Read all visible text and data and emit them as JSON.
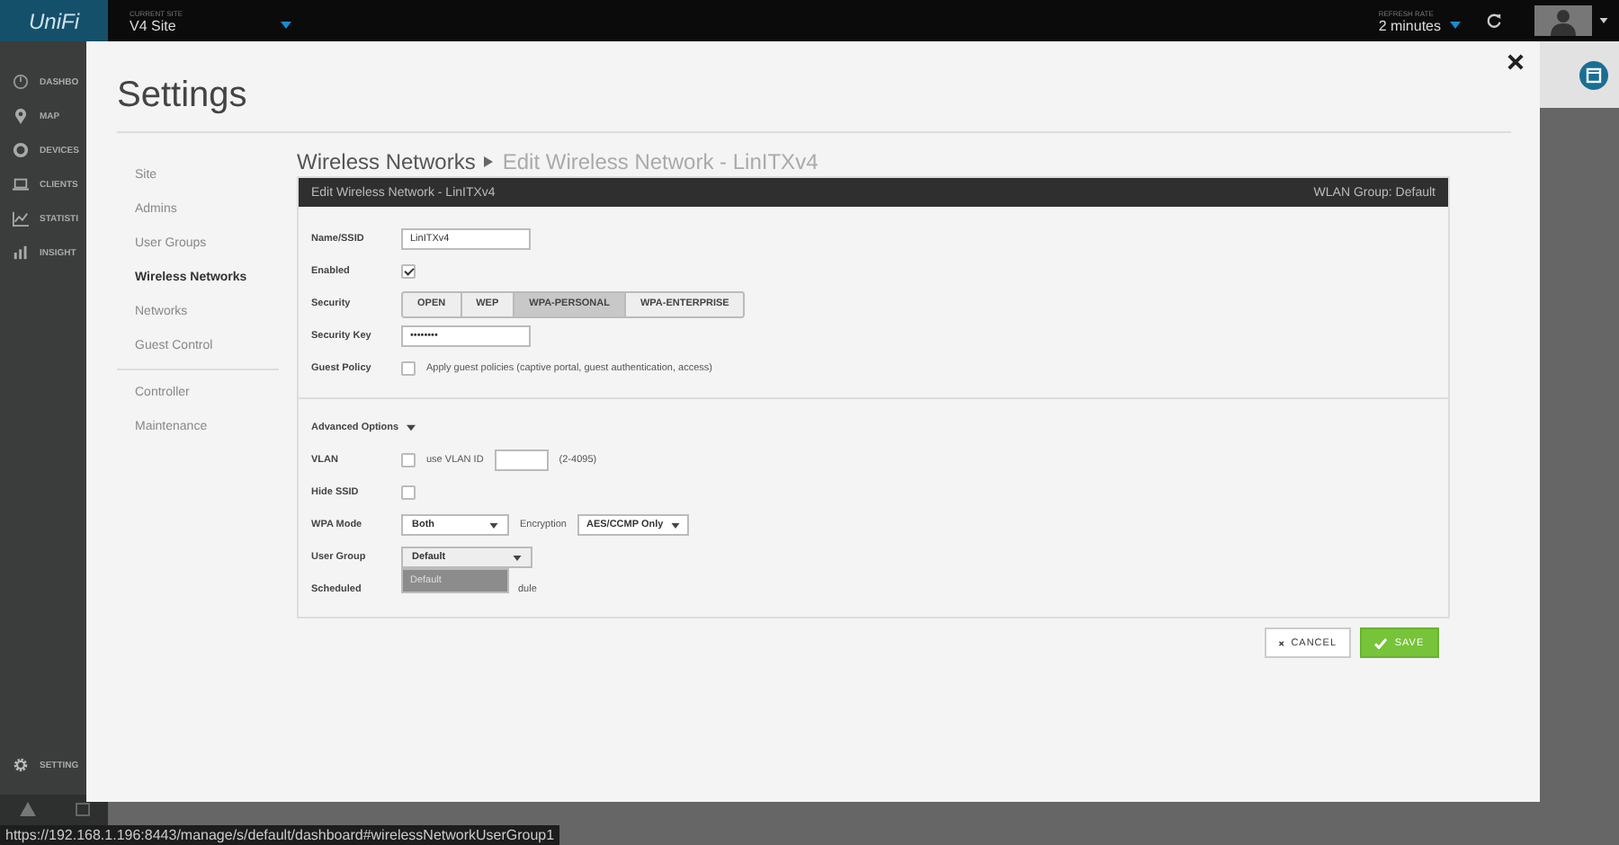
{
  "topbar": {
    "logo": "UniFi",
    "site_label": "CURRENT SITE",
    "site": "V4 Site",
    "refresh_label": "REFRESH RATE",
    "refresh": "2 minutes"
  },
  "sidebar": {
    "items": [
      {
        "kind": "dashboard",
        "label": "DASHBO"
      },
      {
        "kind": "map",
        "label": "MAP"
      },
      {
        "kind": "devices",
        "label": "DEVICES"
      },
      {
        "kind": "clients",
        "label": "CLIENTS"
      },
      {
        "kind": "statistics",
        "label": "STATISTI"
      },
      {
        "kind": "insights",
        "label": "INSIGHT"
      }
    ],
    "settings": "SETTING"
  },
  "modal": {
    "title": "Settings",
    "nav_groups": [
      [
        {
          "label": "Site",
          "selected": false
        },
        {
          "label": "Admins",
          "selected": false
        },
        {
          "label": "User Groups",
          "selected": false
        },
        {
          "label": "Wireless Networks",
          "selected": true
        },
        {
          "label": "Networks",
          "selected": false
        },
        {
          "label": "Guest Control",
          "selected": false
        }
      ],
      [
        {
          "label": "Controller",
          "selected": false
        },
        {
          "label": "Maintenance",
          "selected": false
        }
      ]
    ],
    "breadcrumb": [
      "Wireless Networks",
      "Edit Wireless Network - LinITXv4"
    ],
    "panel": {
      "title": "Edit Wireless Network - LinITXv4",
      "wlan_group": "WLAN Group: Default",
      "rows": [
        {
          "kind": "text",
          "label": "Name/SSID",
          "value": "LinITXv4"
        },
        {
          "kind": "checkbox",
          "label": "Enabled",
          "checked": true
        },
        {
          "kind": "segmented",
          "label": "Security",
          "options": [
            {
              "label": "OPEN",
              "selected": false
            },
            {
              "label": "WEP",
              "selected": false
            },
            {
              "label": "WPA-PERSONAL",
              "selected": true
            },
            {
              "label": "WPA-ENTERPRISE",
              "selected": false
            }
          ]
        },
        {
          "kind": "text",
          "label": "Security Key",
          "value": "••••••••"
        },
        {
          "kind": "checkbox",
          "label": "Guest Policy",
          "checked": false,
          "text": "Apply guest policies (captive portal, guest authentication, access)"
        }
      ],
      "advanced": {
        "label": "Advanced Options",
        "expanded": true,
        "rows": [
          {
            "kind": "vlan",
            "label": "VLAN",
            "checked": false,
            "text": "use VLAN ID",
            "hint": "(2-4095)"
          },
          {
            "kind": "checkbox",
            "label": "Hide SSID",
            "checked": false
          },
          {
            "kind": "selects",
            "label": "WPA Mode",
            "selects": [
              {
                "value": "Both"
              },
              {
                "label": "Encryption",
                "value": "AES/CCMP Only"
              }
            ]
          },
          {
            "kind": "dropdown",
            "label": "User Group",
            "value": "Default",
            "expanded": true,
            "options": [
              {
                "label": "Default",
                "selected": true
              }
            ]
          },
          {
            "kind": "covered",
            "label": "Scheduled",
            "text": "dule"
          }
        ]
      }
    },
    "buttons": [
      {
        "kind": "cancel",
        "label": "CANCEL"
      },
      {
        "kind": "save",
        "label": "SAVE"
      }
    ]
  },
  "status_url": "https://192.168.1.196:8443/manage/s/default/dashboard#wirelessNetworkUserGroup1"
}
